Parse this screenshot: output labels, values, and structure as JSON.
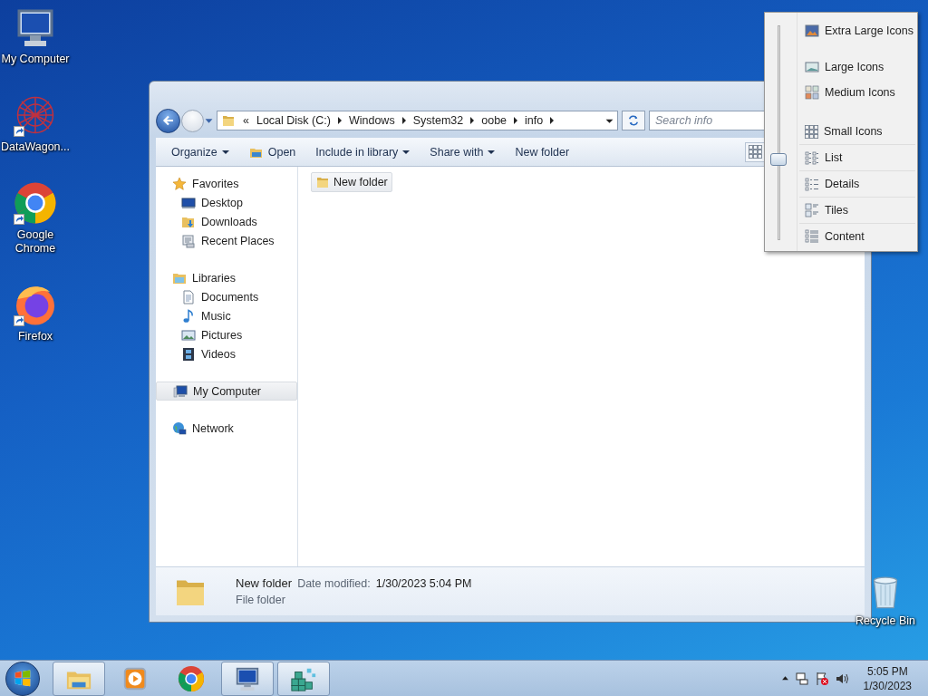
{
  "desktop_icons": [
    {
      "label": "My Computer",
      "kind": "computer",
      "shortcut": false
    },
    {
      "label": "DataWagon...",
      "kind": "mesh",
      "shortcut": true
    },
    {
      "label": "Google Chrome",
      "kind": "chrome",
      "shortcut": true
    },
    {
      "label": "Firefox",
      "kind": "firefox",
      "shortcut": true
    }
  ],
  "recycle_bin": {
    "label": "Recycle Bin"
  },
  "window": {
    "address": {
      "overflow": "«",
      "crumbs": [
        "Local Disk (C:)",
        "Windows",
        "System32",
        "oobe",
        "info"
      ]
    },
    "search": {
      "placeholder": "Search info"
    },
    "toolbar": [
      {
        "label": "Organize",
        "kind": "menu"
      },
      {
        "label": "Open",
        "kind": "open"
      },
      {
        "label": "Include in library",
        "kind": "menu"
      },
      {
        "label": "Share with",
        "kind": "menu"
      },
      {
        "label": "New folder",
        "kind": "plain"
      }
    ],
    "sidebar": [
      {
        "label": "Favorites",
        "kind": "favorites",
        "selected": false,
        "children": [
          {
            "label": "Desktop",
            "kind": "desktop",
            "selected": false
          },
          {
            "label": "Downloads",
            "kind": "downloads",
            "selected": false
          },
          {
            "label": "Recent Places",
            "kind": "recent",
            "selected": false
          }
        ]
      },
      {
        "label": "Libraries",
        "kind": "libraries",
        "selected": false,
        "children": [
          {
            "label": "Documents",
            "kind": "documents",
            "selected": false
          },
          {
            "label": "Music",
            "kind": "music",
            "selected": false
          },
          {
            "label": "Pictures",
            "kind": "pictures",
            "selected": false
          },
          {
            "label": "Videos",
            "kind": "videos",
            "selected": false
          }
        ]
      },
      {
        "label": "My Computer",
        "kind": "computer",
        "selected": true
      },
      {
        "label": "Network",
        "kind": "network",
        "selected": false
      }
    ],
    "files": [
      {
        "name": "New folder",
        "selected": true
      }
    ],
    "details": {
      "name": "New folder",
      "date_label": "Date modified:",
      "date": "1/30/2023 5:04 PM",
      "type": "File folder"
    }
  },
  "view_menu": {
    "level": 0.375,
    "items": [
      {
        "label": "Extra Large Icons",
        "kind": "xl"
      },
      {
        "label": "Large Icons",
        "kind": "large"
      },
      {
        "label": "Medium Icons",
        "kind": "medium"
      },
      {
        "label": "Small Icons",
        "kind": "small"
      },
      {
        "label": "List",
        "kind": "list"
      },
      {
        "label": "Details",
        "kind": "details"
      },
      {
        "label": "Tiles",
        "kind": "tiles"
      },
      {
        "label": "Content",
        "kind": "content"
      }
    ]
  },
  "taskbar": {
    "apps": [
      {
        "kind": "explorer",
        "running": true
      },
      {
        "kind": "media",
        "running": false
      },
      {
        "kind": "chrome",
        "running": false
      },
      {
        "kind": "computer",
        "running": true
      },
      {
        "kind": "cubes",
        "running": true
      }
    ],
    "time": "5:05 PM",
    "date": "1/30/2023"
  }
}
